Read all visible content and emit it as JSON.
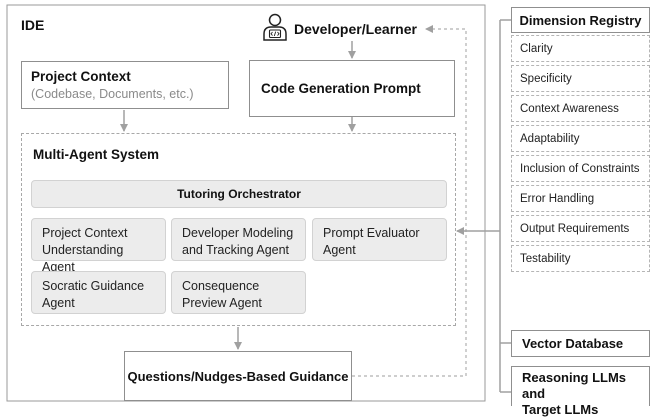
{
  "ide": {
    "label": "IDE"
  },
  "developer": {
    "label": "Developer/Learner",
    "icon": "developer-icon"
  },
  "project_context": {
    "title": "Project Context",
    "subtitle": "(Codebase, Documents, etc.)"
  },
  "code_prompt": {
    "title": "Code Generation Prompt"
  },
  "multi_agent": {
    "title": "Multi-Agent System",
    "orchestrator": "Tutoring Orchestrator",
    "agents": [
      {
        "line1": "Project Context",
        "line2": "Understanding Agent"
      },
      {
        "line1": "Developer Modeling",
        "line2": "and Tracking Agent"
      },
      {
        "line1": "Prompt Evaluator",
        "line2": "Agent"
      },
      {
        "line1": "Socratic Guidance",
        "line2": "Agent"
      },
      {
        "line1": "Consequence",
        "line2": "Preview Agent"
      }
    ]
  },
  "guidance": {
    "title": "Questions/Nudges-Based Guidance"
  },
  "registry": {
    "title": "Dimension Registry",
    "items": [
      "Clarity",
      "Specificity",
      "Context Awareness",
      "Adaptability",
      "Inclusion of Constraints",
      "Error Handling",
      "Output Requirements",
      "Testability"
    ]
  },
  "vector_db": {
    "title": "Vector Database"
  },
  "llms": {
    "line1": "Reasoning LLMs and",
    "line2": "Target LLMs"
  }
}
